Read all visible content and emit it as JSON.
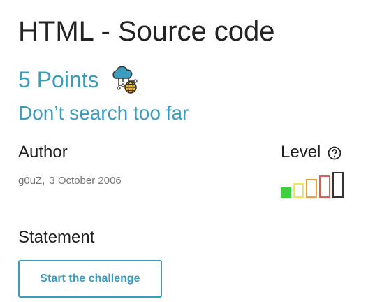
{
  "challenge": {
    "title": "HTML - Source code",
    "points": "5 Points",
    "category_icon": "cloud-network-globe-icon",
    "subtitle": "Don’t search too far"
  },
  "author": {
    "label": "Author",
    "name": "g0uZ",
    "date": "3 October 2006"
  },
  "level": {
    "label": "Level",
    "help_icon": "question-circle-icon",
    "current": 1,
    "max": 5,
    "colors": [
      "#3ecf3e",
      "#f2e55a",
      "#e8a040",
      "#d9604f",
      "#333333"
    ]
  },
  "statement": {
    "label": "Statement",
    "start_button": "Start the challenge"
  },
  "colors": {
    "accent": "#3a9dc0"
  }
}
